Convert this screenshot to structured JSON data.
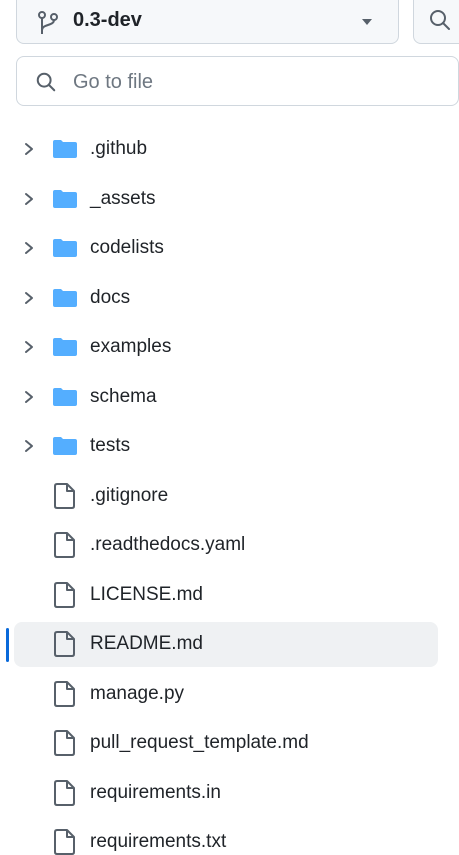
{
  "branch": {
    "name": "0.3-dev"
  },
  "search": {
    "placeholder": "Go to file"
  },
  "tree": {
    "folders": [
      {
        "label": ".github"
      },
      {
        "label": "_assets"
      },
      {
        "label": "codelists"
      },
      {
        "label": "docs"
      },
      {
        "label": "examples"
      },
      {
        "label": "schema"
      },
      {
        "label": "tests"
      }
    ],
    "files": [
      {
        "label": ".gitignore"
      },
      {
        "label": ".readthedocs.yaml"
      },
      {
        "label": "LICENSE.md"
      },
      {
        "label": "README.md",
        "selected": true
      },
      {
        "label": "manage.py"
      },
      {
        "label": "pull_request_template.md"
      },
      {
        "label": "requirements.in"
      },
      {
        "label": "requirements.txt"
      }
    ]
  },
  "colors": {
    "folder": "#54aeff",
    "accent": "#0969da",
    "selected_bg": "#eff1f3"
  },
  "icons": {
    "branch": "git-branch-icon",
    "search": "search-icon",
    "caret": "triangle-down-icon",
    "chevron": "chevron-right-icon",
    "folder": "folder-icon",
    "file": "file-icon"
  }
}
